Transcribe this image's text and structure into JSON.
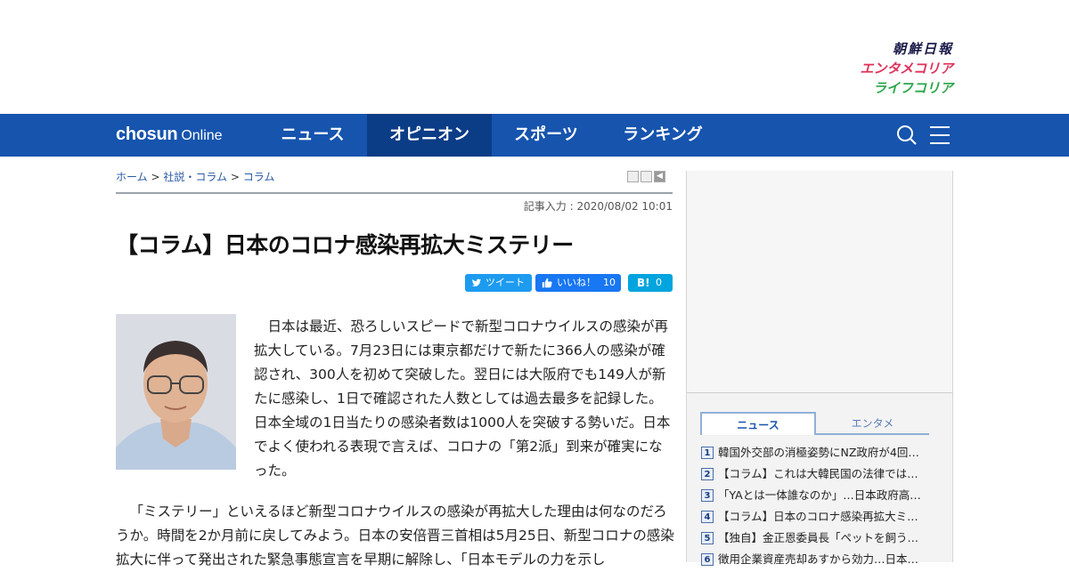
{
  "brands": {
    "chosun": "朝鮮日報",
    "entame": "エンタメコリア",
    "life": "ライフコリア"
  },
  "nav": {
    "logo_bold": "chosun",
    "logo_regular": "Online",
    "items": [
      "ニュース",
      "オピニオン",
      "スポーツ",
      "ランキング"
    ],
    "active": "オピニオン"
  },
  "breadcrumb": {
    "home": "ホーム",
    "section": "社説・コラム",
    "current": "コラム",
    "sep": ">"
  },
  "article": {
    "dateline": "記事入力 : 2020/08/02 10:01",
    "title": "【コラム】日本のコロナ感染再拡大ミステリー",
    "lead": "日本は最近、恐ろしいスピードで新型コロナウイルスの感染が再拡大している。7月23日には東京都だけで新たに366人の感染が確認され、300人を初めて突破した。翌日には大阪府でも149人が新たに感染し、1日で確認された人数としては過去最多を記録した。日本全域の1日当たりの感染者数は1000人を突破する勢いだ。日本でよく使われる表現で言えば、コロナの「第2派」到来が確実になった。",
    "para2": "「ミステリー」といえるほど新型コロナウイルスの感染が再拡大した理由は何なのだろうか。時間を2か月前に戻してみよう。日本の安倍晋三首相は5月25日、新型コロナの感染拡大に伴って発出された緊急事態宣言を早期に解除し、「日本モデルの力を示し"
  },
  "share": {
    "tweet": "ツイート",
    "like": "いいね！",
    "like_count": "10",
    "hatena": "B!",
    "hatena_count": "0"
  },
  "sidebar": {
    "tabs": [
      "ニュース",
      "エンタメ"
    ],
    "ranking": [
      "韓国外交部の消極姿勢にNZ政府が4回…",
      "【コラム】これは大韓民国の法律では…",
      "「YAとは一体誰なのか」…日本政府高…",
      "【コラム】日本のコロナ感染再拡大ミ…",
      "【独自】金正恩委員長「ペットを飼う…",
      "徴用企業資産売却あすから効力…日本…"
    ]
  },
  "colors": {
    "nav_bg": "#1654ae",
    "nav_active": "#0b3c86",
    "twitter": "#1d9bf0",
    "facebook": "#1877f2",
    "hatena": "#00a4de"
  }
}
